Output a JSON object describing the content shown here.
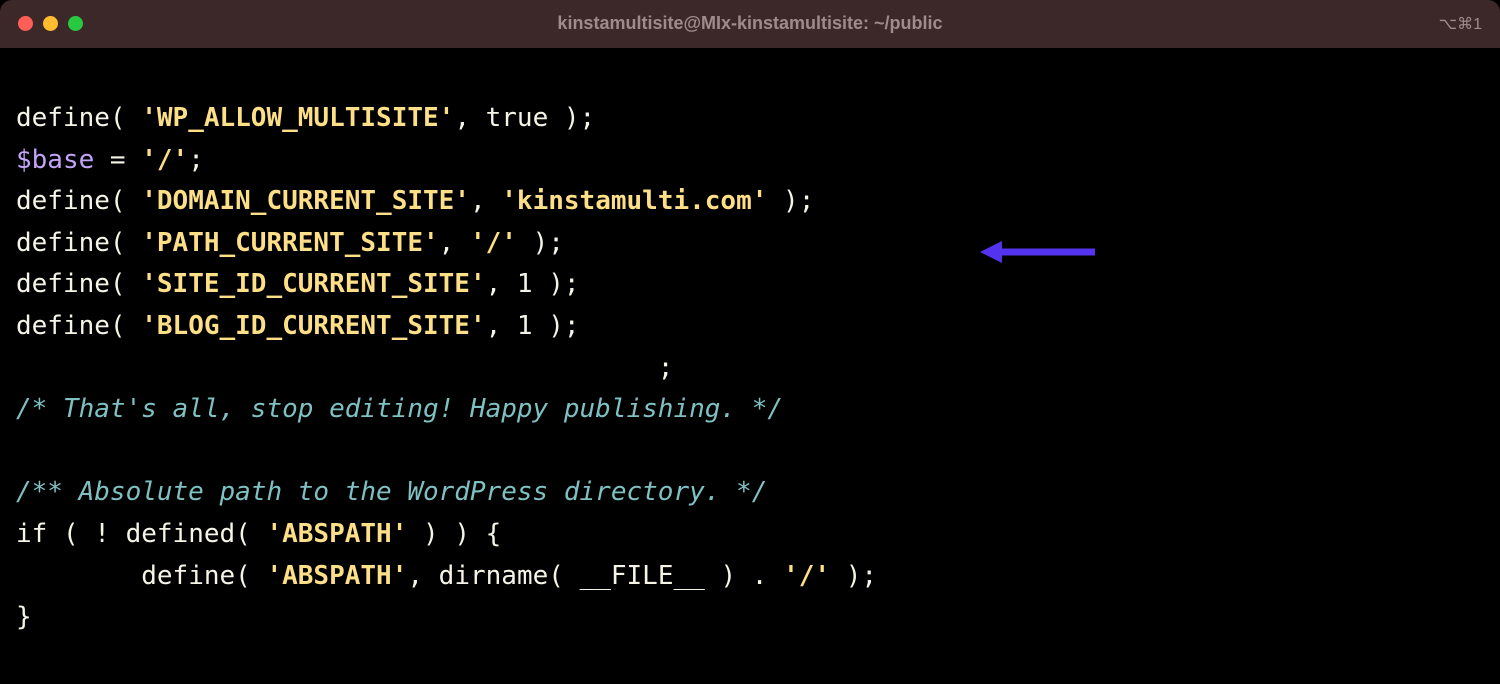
{
  "titlebar": {
    "title": "kinstamultisite@MIx-kinstamultisite: ~/public",
    "shortcut": "⌥⌘1"
  },
  "code": {
    "l1": {
      "fn": "define",
      "open": "( ",
      "str": "'WP_ALLOW_MULTISITE'",
      "comma": ", ",
      "val": "true",
      "close": " );"
    },
    "l2": {
      "var": "$base",
      "eq": " = ",
      "str": "'/'",
      "semi": ";"
    },
    "l3": {
      "fn": "define",
      "open": "( ",
      "str": "'DOMAIN_CURRENT_SITE'",
      "comma": ", ",
      "str2": "'kinstamulti.com'",
      "close": " );"
    },
    "l4": {
      "fn": "define",
      "open": "( ",
      "str": "'PATH_CURRENT_SITE'",
      "comma": ", ",
      "str2": "'/'",
      "close": " );"
    },
    "l5": {
      "fn": "define",
      "open": "( ",
      "str": "'SITE_ID_CURRENT_SITE'",
      "comma": ", ",
      "val": "1",
      "close": " );"
    },
    "l6": {
      "fn": "define",
      "open": "( ",
      "str": "'BLOG_ID_CURRENT_SITE'",
      "comma": ", ",
      "val": "1",
      "close": " );"
    },
    "l7": {
      "pad": "                                         ",
      "semi": ";"
    },
    "l8": {
      "comment": "/* That's all, stop editing! Happy publishing. */"
    },
    "l9": "",
    "l10": {
      "comment": "/** Absolute path to the WordPress directory. */"
    },
    "l11": {
      "p1": "if ( ! ",
      "fn": "defined",
      "open": "( ",
      "str": "'ABSPATH'",
      "close": " ) ) {"
    },
    "l12": {
      "pad": "        ",
      "fn": "define",
      "open": "( ",
      "str": "'ABSPATH'",
      "comma": ", ",
      "fn2": "dirname",
      "open2": "( ",
      "const": "__FILE__",
      "close2": " ) . ",
      "str2": "'/'",
      "close": " );"
    },
    "l13": {
      "brace": "}"
    }
  }
}
